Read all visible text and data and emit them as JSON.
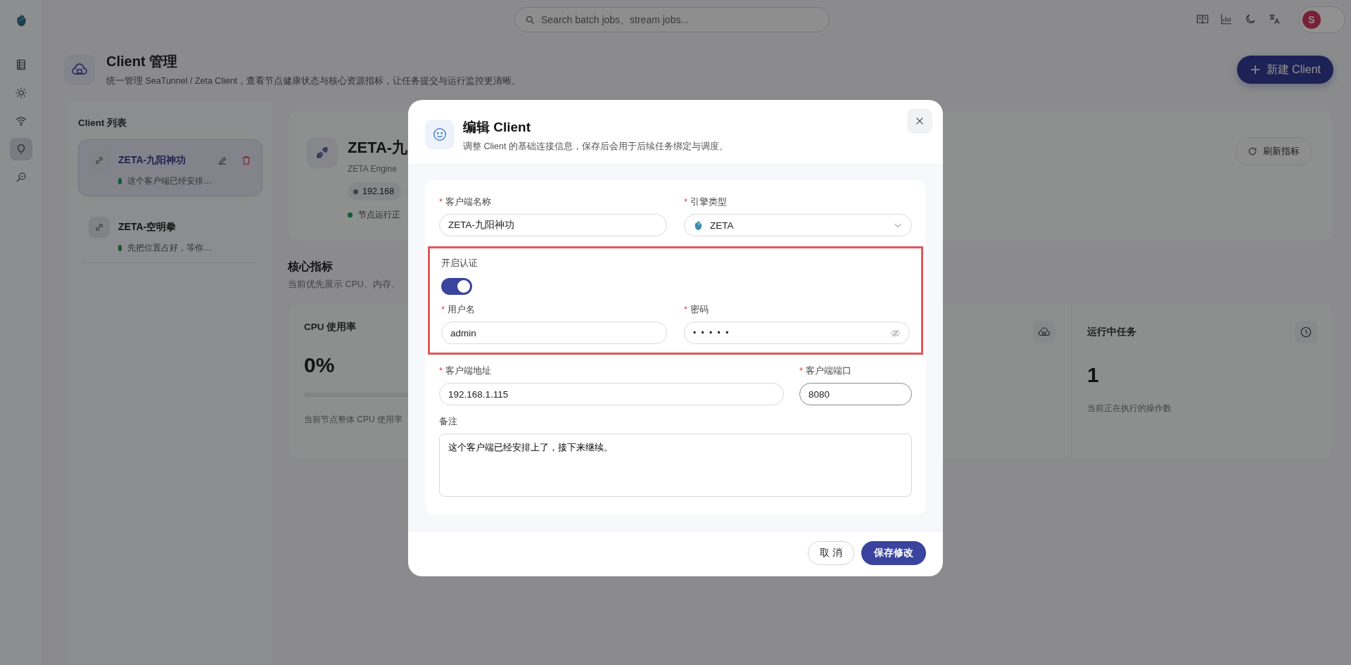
{
  "nav": [
    {
      "kind": "table",
      "selected": false
    },
    {
      "kind": "sun",
      "selected": false
    },
    {
      "kind": "wifi",
      "selected": false
    },
    {
      "kind": "bulb",
      "selected": true
    },
    {
      "kind": "search",
      "selected": false
    }
  ],
  "search": {
    "placeholder": "Search batch jobs、stream jobs..."
  },
  "toolbar": [
    {
      "kind": "book"
    },
    {
      "kind": "chart"
    },
    {
      "kind": "moon"
    },
    {
      "kind": "translate"
    }
  ],
  "avatar": {
    "letter": "S"
  },
  "header": {
    "title": "Client 管理",
    "subtitle": "统一管理 SeaTunnel / Zeta Client，查看节点健康状态与核心资源指标，让任务提交与运行监控更清晰。",
    "new_button": "新建 Client"
  },
  "client_list": {
    "title": "Client 列表",
    "items": [
      {
        "name": "ZETA-九阳神功",
        "note": "这个客户端已经安排…",
        "selected": true
      },
      {
        "name": "ZETA-空明拳",
        "note": "先把位置占好，等你…",
        "selected": false
      }
    ]
  },
  "detail": {
    "title": "ZETA-九",
    "engine": "ZETA Engine",
    "address": "192.168",
    "status": "节点运行正",
    "refresh_button": "刷新指标"
  },
  "metrics": {
    "title": "核心指标",
    "subtitle": "当前优先展示 CPU、内存、",
    "cards": [
      {
        "kind": "gauge",
        "title": "CPU 使用率",
        "value": "0%",
        "level": 0,
        "note": "当前节点整体 CPU 使用率"
      },
      {
        "kind": "hidden"
      },
      {
        "kind": "icon_only"
      },
      {
        "kind": "count",
        "title": "运行中任务",
        "value": "1",
        "note": "当前正在执行的操作数"
      }
    ]
  },
  "modal": {
    "title": "编辑 Client",
    "subtitle": "调整 Client 的基础连接信息，保存后会用于后续任务绑定与调度。",
    "name": {
      "asterisk": "*",
      "label": "客户端名称",
      "value": "ZETA-九阳神功"
    },
    "engine": {
      "asterisk": "*",
      "label": "引擎类型",
      "value": "ZETA"
    },
    "auth": {
      "label": "开启认证",
      "on": true,
      "highlighted": true
    },
    "username": {
      "asterisk": "*",
      "label": "用户名",
      "value": "admin"
    },
    "password": {
      "asterisk": "*",
      "label": "密码",
      "value": "• • • • •"
    },
    "address": {
      "asterisk": "*",
      "label": "客户端地址",
      "value": "192.168.1.115"
    },
    "port": {
      "asterisk": "*",
      "label": "客户端端口",
      "value": "8080"
    },
    "remark": {
      "label": "备注",
      "value": "这个客户端已经安排上了，接下来继续。"
    },
    "cancel_button": "取 消",
    "save_button": "保存修改"
  }
}
